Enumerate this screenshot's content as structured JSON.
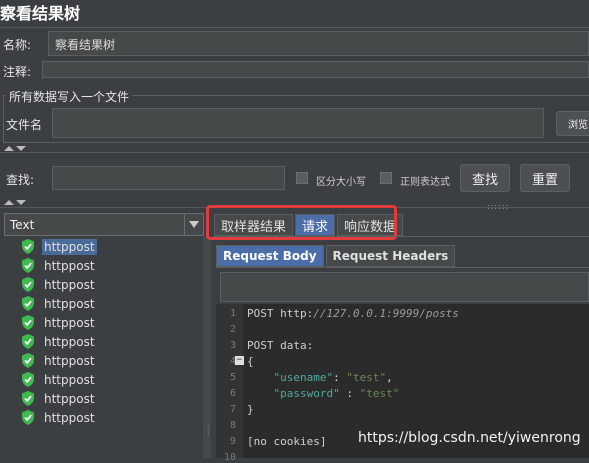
{
  "title": "察看结果树",
  "name_label": "名称:",
  "name_value": "察看结果树",
  "comment_label": "注释:",
  "write_all_label": "所有数据写入一个文件",
  "filename_label": "文件名",
  "browse_label": "浏览",
  "search_label": "查找:",
  "case_sensitive_label": "区分大小写",
  "regex_label": "正则表达式",
  "find_button": "查找",
  "reset_button": "重置",
  "renderer_value": "Text",
  "tree_items": [
    "httppost",
    "httppost",
    "httppost",
    "httppost",
    "httppost",
    "httppost",
    "httppost",
    "httppost",
    "httppost",
    "httppost"
  ],
  "result_tabs": [
    "取样器结果",
    "请求",
    "响应数据"
  ],
  "request_tabs": [
    "Request Body",
    "Request Headers"
  ],
  "code_lines": [
    {
      "n": "1",
      "parts": [
        {
          "t": "POST http:",
          "c": ""
        },
        {
          "t": "//127.0.0.1:9999/posts",
          "c": "s-url"
        }
      ]
    },
    {
      "n": "2",
      "parts": []
    },
    {
      "n": "3",
      "parts": [
        {
          "t": "POST data:",
          "c": ""
        }
      ]
    },
    {
      "n": "4",
      "parts": [
        {
          "t": "{",
          "c": ""
        }
      ]
    },
    {
      "n": "5",
      "parts": [
        {
          "t": "    ",
          "c": ""
        },
        {
          "t": "\"usename\"",
          "c": "s-key"
        },
        {
          "t": ": ",
          "c": ""
        },
        {
          "t": "\"test\"",
          "c": "s-str"
        },
        {
          "t": ",",
          "c": ""
        }
      ]
    },
    {
      "n": "6",
      "parts": [
        {
          "t": "    ",
          "c": ""
        },
        {
          "t": "\"password\"",
          "c": "s-key"
        },
        {
          "t": " : ",
          "c": ""
        },
        {
          "t": "\"test\"",
          "c": "s-str"
        }
      ]
    },
    {
      "n": "7",
      "parts": [
        {
          "t": "}",
          "c": ""
        }
      ]
    },
    {
      "n": "8",
      "parts": []
    },
    {
      "n": "9",
      "parts": [
        {
          "t": "[no cookies]",
          "c": ""
        }
      ]
    },
    {
      "n": "10",
      "parts": []
    }
  ],
  "watermark": "https://blog.csdn.net/yiwenrong",
  "colors": {
    "highlight": "#e23b3b",
    "tab_active": "#4b6ea8",
    "shield": "#3fb950"
  }
}
